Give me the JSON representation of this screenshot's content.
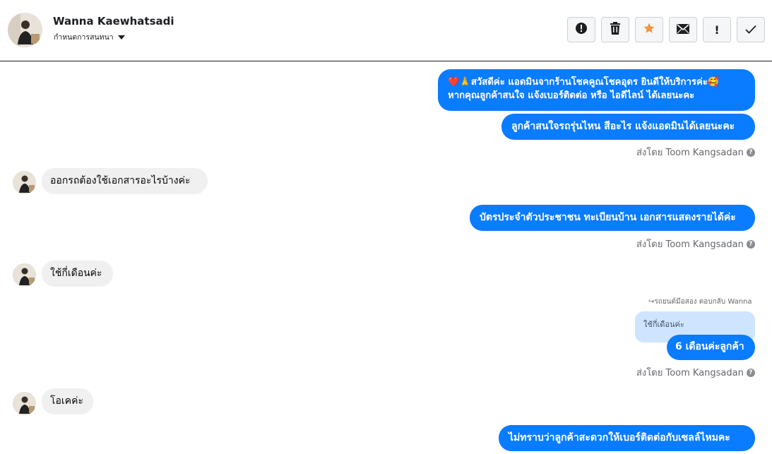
{
  "header": {
    "contact_name": "Wanna Kaewhatsadi",
    "assign_label": "กำหนดการสนทนา",
    "actions": [
      {
        "icon": "alert-circle-icon",
        "glyph": "!"
      },
      {
        "icon": "trash-icon"
      },
      {
        "icon": "star-icon",
        "color": "#f7923a"
      },
      {
        "icon": "mail-icon"
      },
      {
        "icon": "exclamation-icon",
        "glyph": "!"
      },
      {
        "icon": "check-icon",
        "glyph": "✓"
      }
    ]
  },
  "colors": {
    "outgoing_bubble": "#0a7cff",
    "incoming_bubble": "#f0f0f0",
    "quote_bubble": "#cfe4ff"
  },
  "messages": {
    "m1_line1": "❤️🙏สวัสดีค่ะ แอดมินจากร้านโชคคูณโชคอุดร ยินดีให้บริการค่ะ🥰",
    "m1_line2": "หากคุณลูกค้าสนใจ แจ้งเบอร์ติดต่อ หรือ ไอดีไลน์ ได้เลยนะคะ",
    "m2": "ลูกค้าสนใจรถรุ่นไหน สีอะไร แจ้งแอดมินได้เลยนะคะ",
    "sent_by_1": "ส่งโดย Toom Kangsadan",
    "m3": "ออกรถต้องใช้เอกสารอะไรบ้างค่ะ",
    "m4": "บัตรประจำตัวประชาชน ทะเบียนบ้าน เอกสารแสดงรายได้ค่ะ",
    "sent_by_2": "ส่งโดย Toom Kangsadan",
    "m5": "ใช้กี่เดือนค่ะ",
    "reply_note": "รถยนต์มือสอง ตอบกลับ Wanna",
    "quoted": "ใช้กี่เดือนค่ะ",
    "m6": "6 เดือนค่ะลูกค้า",
    "sent_by_3": "ส่งโดย Toom Kangsadan",
    "m7": "โอเคค่ะ",
    "m8": "ไม่ทราบว่าลูกค้าสะดวกให้เบอร์ติดต่อกับเซลล์ไหมคะ"
  }
}
